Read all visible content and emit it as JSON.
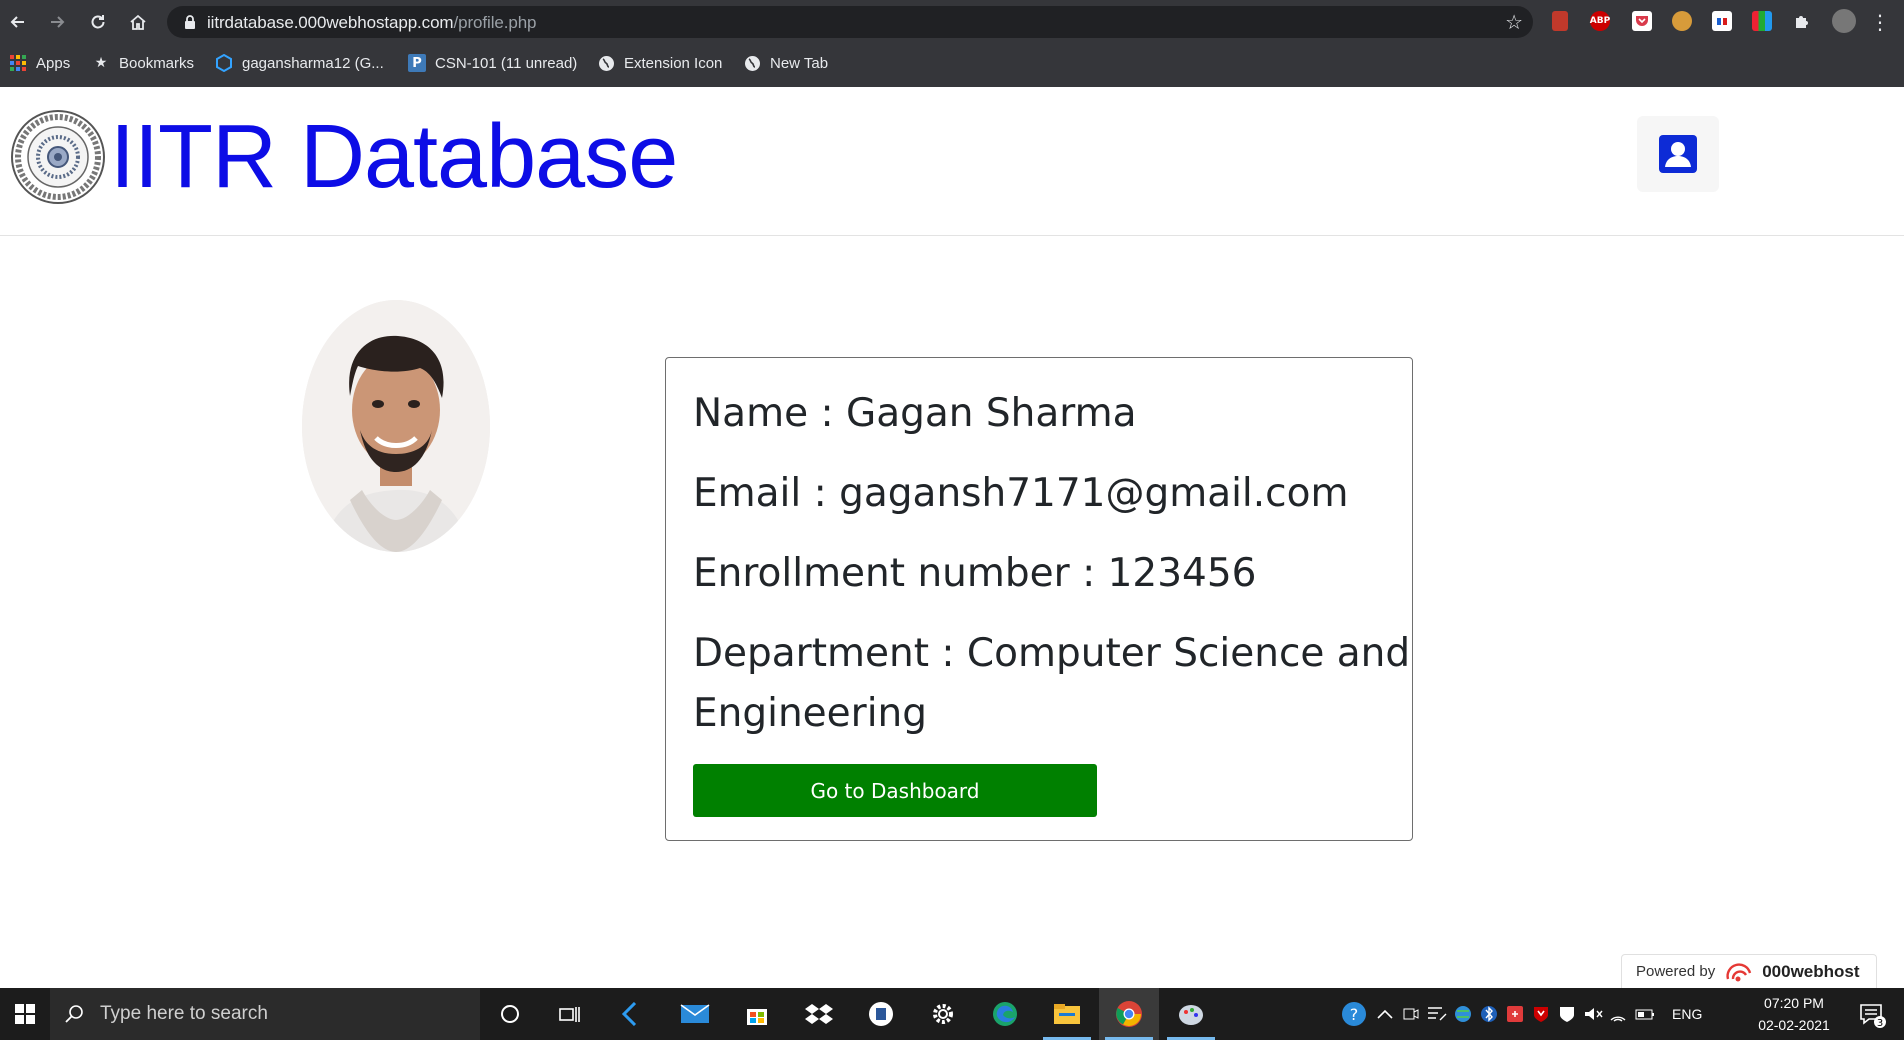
{
  "browser": {
    "url_host": "iitrdatabase.000webhostapp.com",
    "url_path": "/profile.php",
    "bookmarks": [
      {
        "label": "Apps",
        "icon": "apps-grid-icon"
      },
      {
        "label": "Bookmarks",
        "icon": "star-icon"
      },
      {
        "label": "gagansharma12 (G...",
        "icon": "hexagon-icon"
      },
      {
        "label": "CSN-101 (11 unread)",
        "icon": "piazza-icon"
      },
      {
        "label": "Extension Icon",
        "icon": "globe-icon"
      },
      {
        "label": "New Tab",
        "icon": "globe-icon"
      }
    ],
    "extensions": {
      "abp_label": "ABP"
    }
  },
  "site": {
    "title": "IITR Database",
    "title_color": "#0d0de6"
  },
  "profile": {
    "name_line": "Name : Gagan Sharma",
    "email_line": "Email : gagansh7171@gmail.com",
    "enrollment_line": "Enrollment number : 123456",
    "department_line_1": "Department : Computer Science and",
    "department_line_2": "Engineering",
    "dashboard_button": "Go to Dashboard",
    "button_color": "#008000"
  },
  "footer": {
    "powered_by": "Powered by",
    "brand": "000webhost"
  },
  "taskbar": {
    "search_placeholder": "Type here to search",
    "language": "ENG",
    "time": "07:20 PM",
    "date": "02-02-2021",
    "notification_count": "3"
  }
}
